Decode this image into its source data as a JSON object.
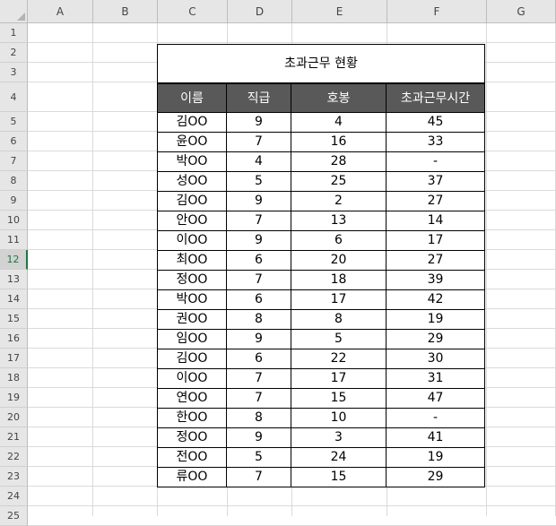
{
  "columns": [
    "A",
    "B",
    "C",
    "D",
    "E",
    "F",
    "G"
  ],
  "rows": [
    "1",
    "2",
    "3",
    "4",
    "5",
    "6",
    "7",
    "8",
    "9",
    "10",
    "11",
    "12",
    "13",
    "14",
    "15",
    "16",
    "17",
    "18",
    "19",
    "20",
    "21",
    "22",
    "23",
    "24",
    "25"
  ],
  "active_row": "12",
  "table": {
    "title": "초과근무 현황",
    "headers": [
      "이름",
      "직급",
      "호봉",
      "초과근무시간"
    ],
    "rows": [
      [
        "김OO",
        "9",
        "4",
        "45"
      ],
      [
        "윤OO",
        "7",
        "16",
        "33"
      ],
      [
        "박OO",
        "4",
        "28",
        "-"
      ],
      [
        "성OO",
        "5",
        "25",
        "37"
      ],
      [
        "김OO",
        "9",
        "2",
        "27"
      ],
      [
        "안OO",
        "7",
        "13",
        "14"
      ],
      [
        "이OO",
        "9",
        "6",
        "17"
      ],
      [
        "최OO",
        "6",
        "20",
        "27"
      ],
      [
        "정OO",
        "7",
        "18",
        "39"
      ],
      [
        "박OO",
        "6",
        "17",
        "42"
      ],
      [
        "권OO",
        "8",
        "8",
        "19"
      ],
      [
        "임OO",
        "9",
        "5",
        "29"
      ],
      [
        "김OO",
        "6",
        "22",
        "30"
      ],
      [
        "이OO",
        "7",
        "17",
        "31"
      ],
      [
        "연OO",
        "7",
        "15",
        "47"
      ],
      [
        "한OO",
        "8",
        "10",
        "-"
      ],
      [
        "정OO",
        "9",
        "3",
        "41"
      ],
      [
        "전OO",
        "5",
        "24",
        "19"
      ],
      [
        "류OO",
        "7",
        "15",
        "29"
      ]
    ]
  },
  "colors": {
    "header_fill": "#595959",
    "header_text": "#ffffff",
    "active_row_accent": "#217346"
  }
}
